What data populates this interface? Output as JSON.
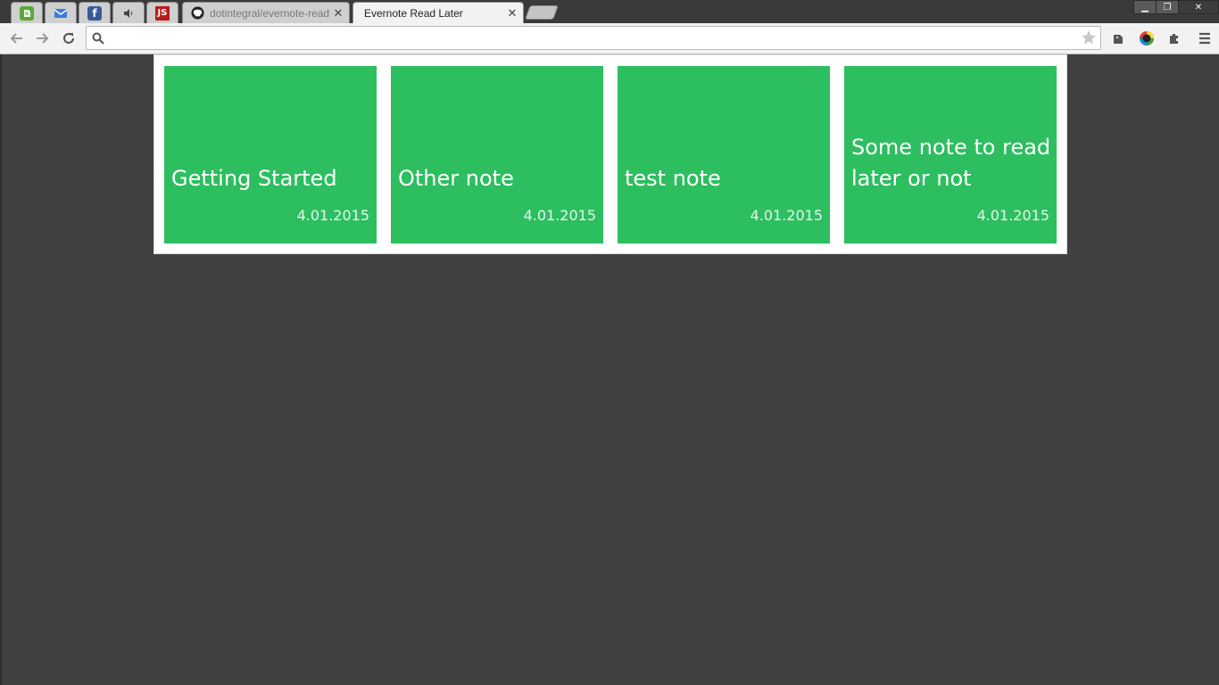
{
  "browser": {
    "tabs": [
      {
        "label": "",
        "icon": "evernote-icon",
        "active": false
      },
      {
        "label": "",
        "icon": "mail-icon",
        "active": false
      },
      {
        "label": "",
        "icon": "facebook-icon",
        "active": false
      },
      {
        "label": "",
        "icon": "speaker-icon",
        "active": false
      },
      {
        "label": "",
        "icon": "js-icon",
        "favicon_text": "JS",
        "active": false
      },
      {
        "label": "dotintegral/evernote-read",
        "icon": "github-icon",
        "active": false
      },
      {
        "label": "Evernote Read Later",
        "icon": "",
        "active": true
      }
    ],
    "window_controls": {
      "minimize": "▁",
      "restore": "❐",
      "close": "✕"
    },
    "omnibox": {
      "value": "",
      "placeholder": ""
    }
  },
  "notes": [
    {
      "title": "Getting Started",
      "date": "4.01.2015"
    },
    {
      "title": "Other note",
      "date": "4.01.2015"
    },
    {
      "title": "test note",
      "date": "4.01.2015"
    },
    {
      "title": "Some note to read later or not",
      "date": "4.01.2015"
    }
  ],
  "colors": {
    "card": "#2dbe60",
    "background": "#404040",
    "board": "#ffffff"
  }
}
